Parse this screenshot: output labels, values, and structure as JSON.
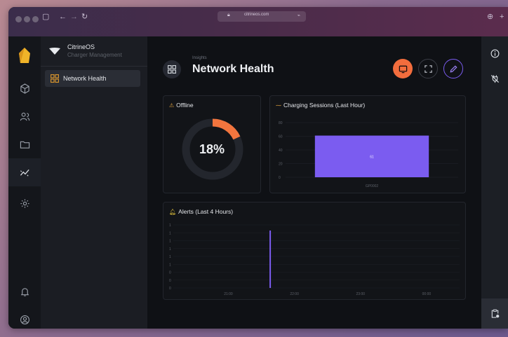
{
  "browser": {
    "url": "citrineos.com",
    "accent_colors": {
      "bar_left": "#3b2d4b",
      "bar_right": "#5b2c4d"
    }
  },
  "brand": {
    "name": "CitrineOS",
    "subtitle": "Charger Management",
    "logo_color": "#f0b429"
  },
  "sidebar": {
    "items": [
      {
        "label": "Network Health",
        "icon": "dashboard-grid-icon",
        "active": true
      }
    ]
  },
  "rail": {
    "icons": [
      "box-icon",
      "users-icon",
      "folder-icon",
      "activity-chart-icon",
      "settings-gear-icon",
      "bell-icon",
      "user-avatar-icon"
    ],
    "active": "activity-chart-icon"
  },
  "header": {
    "breadcrumb": "Insights",
    "title": "Network Health",
    "buttons": [
      {
        "icon": "tv-icon",
        "color": "#f26d3d"
      },
      {
        "icon": "fullscreen-icon",
        "color": "#3a3d45"
      },
      {
        "icon": "edit-pencil-icon",
        "color": "#7b5cf0"
      }
    ]
  },
  "offline_card": {
    "title": "Offline",
    "value_label": "18%",
    "value": 18,
    "accent": "#f2753e"
  },
  "sessions_card": {
    "title": "Charging Sessions (Last Hour)",
    "chart_data": {
      "type": "bar",
      "categories": [
        "GP0002"
      ],
      "values": [
        61
      ],
      "yticks": [
        "80",
        "60",
        "40",
        "20",
        "0"
      ],
      "ylim": [
        0,
        80
      ],
      "bar_color": "#7b5cf0",
      "data_labels": [
        "61"
      ]
    }
  },
  "alerts_card": {
    "title": "Alerts (Last 4 Hours)",
    "chart_data": {
      "type": "bar",
      "xticks": [
        "21:00",
        "22:00",
        "23:00",
        "00:00"
      ],
      "yticks": [
        "1",
        "1",
        "1",
        "1",
        "1",
        "1",
        "0",
        "0",
        "0"
      ],
      "spike_position": "21:38",
      "bar_color": "#7b5cf0"
    }
  },
  "right_rail": {
    "icons": [
      "info-icon",
      "no-plug-icon",
      "clipboard-status-icon"
    ]
  }
}
